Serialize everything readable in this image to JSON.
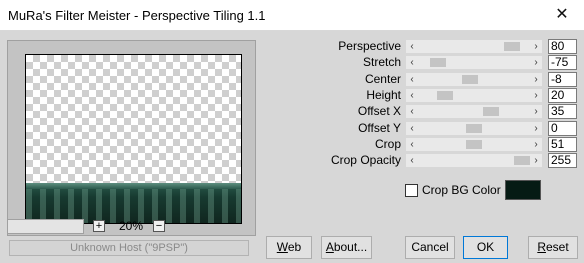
{
  "window": {
    "title": "MuRa's Filter Meister - Perspective Tiling 1.1",
    "close_glyph": "✕"
  },
  "zoom": {
    "plus": "+",
    "value": "20%",
    "minus": "−"
  },
  "status": {
    "text": "Unknown Host (\"9PSP\")"
  },
  "params": [
    {
      "label": "Perspective",
      "value": "80",
      "level": 0.9
    },
    {
      "label": "Stretch",
      "value": "-75",
      "level": 0.12
    },
    {
      "label": "Center",
      "value": "-8",
      "level": 0.46
    },
    {
      "label": "Height",
      "value": "20",
      "level": 0.2
    },
    {
      "label": "Offset X",
      "value": "35",
      "level": 0.68
    },
    {
      "label": "Offset Y",
      "value": "0",
      "level": 0.5
    },
    {
      "label": "Crop",
      "value": "51",
      "level": 0.5
    },
    {
      "label": "Crop Opacity",
      "value": "255",
      "level": 1.0
    }
  ],
  "crop_bg": {
    "label": "Crop BG Color",
    "color": "#061b14",
    "checked": false
  },
  "buttons": {
    "web": {
      "first": "W",
      "rest": "eb"
    },
    "about": {
      "first": "A",
      "rest": "bout..."
    },
    "cancel": "Cancel",
    "ok": "OK",
    "reset": {
      "first": "R",
      "rest": "eset"
    }
  },
  "icons": {
    "arrow_left": "‹",
    "arrow_right": "›"
  }
}
